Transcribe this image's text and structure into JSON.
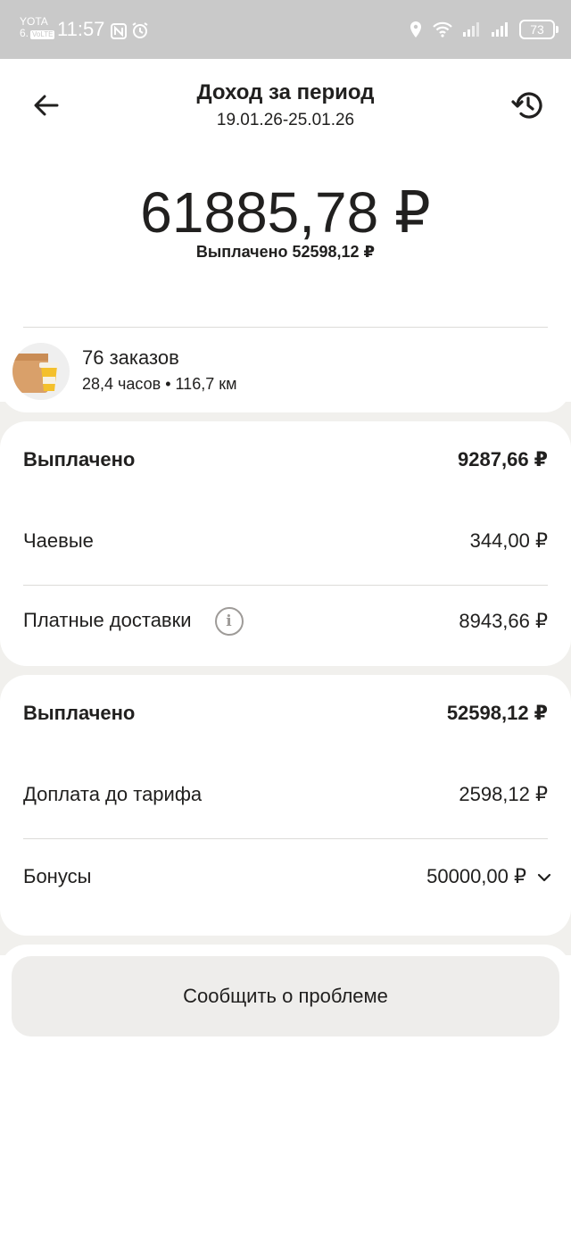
{
  "status_bar": {
    "carrier": "YOTA",
    "network": "6.",
    "volte": "VoLTE",
    "time": "11:57",
    "battery": "73"
  },
  "header": {
    "title": "Доход за период",
    "period": "19.01.26-25.01.26"
  },
  "summary": {
    "amount": "61885,78 ₽",
    "paid": "Выплачено 52598,12 ₽"
  },
  "orders": {
    "title": "76 заказов",
    "details": "28,4 часов • 116,7 км"
  },
  "section1": {
    "rows": [
      {
        "label": "Выплачено",
        "value": "9287,66 ₽"
      },
      {
        "label": "Чаевые",
        "value": "344,00 ₽"
      },
      {
        "label": "Платные доставки",
        "value": "8943,66 ₽"
      }
    ]
  },
  "section2": {
    "rows": [
      {
        "label": "Выплачено",
        "value": "52598,12 ₽"
      },
      {
        "label": "Доплата до тарифа",
        "value": "2598,12 ₽"
      },
      {
        "label": "Бонусы",
        "value": "50000,00 ₽"
      }
    ]
  },
  "actions": {
    "report_problem": "Сообщить о проблеме"
  }
}
